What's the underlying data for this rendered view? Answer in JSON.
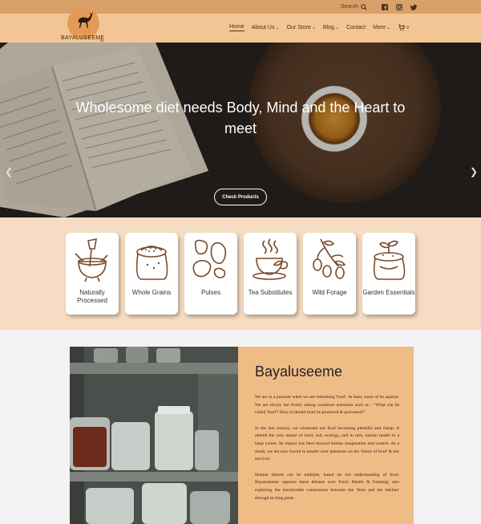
{
  "topbar": {
    "search_label": "Search",
    "icons": [
      "search-icon",
      "facebook-icon",
      "instagram-icon",
      "twitter-icon"
    ]
  },
  "brand": {
    "name": "BAYALUSEEME",
    "tm": "TM"
  },
  "nav": {
    "items": [
      {
        "label": "Home",
        "active": true,
        "dropdown": false
      },
      {
        "label": "About Us",
        "dropdown": true
      },
      {
        "label": "Our Store",
        "dropdown": true
      },
      {
        "label": "Blog",
        "dropdown": true
      },
      {
        "label": "Contact",
        "dropdown": false
      },
      {
        "label": "More",
        "dropdown": true
      }
    ],
    "cart_count": "0"
  },
  "hero": {
    "title": "Wholesome diet needs Body, Mind and the Heart to meet",
    "button": "Check Products",
    "prev_icon": "chevron-left-icon",
    "next_icon": "chevron-right-icon"
  },
  "categories": [
    {
      "label": "Naturally Processed",
      "icon": "mortar-pestle-icon"
    },
    {
      "label": "Whole Grains",
      "icon": "grain-sack-icon"
    },
    {
      "label": "Pulses",
      "icon": "beans-icon"
    },
    {
      "label": "Tea Substitutes",
      "icon": "tea-cup-icon"
    },
    {
      "label": "Wild Forage",
      "icon": "berries-branch-icon"
    },
    {
      "label": "Garden Essentials",
      "icon": "seedling-sack-icon"
    }
  ],
  "about": {
    "title": "Bayaluseeme",
    "paragraphs": [
      "We are at a juncture when we are rethinking 'food'. At least, some of its aspects. We are slowly but firmly asking ourselves questions such as - \"What can be called 'food'? How is should (not) be produced & processed?\"",
      "In the last century, we witnessed our food becoming plentiful and cheap. It altered the very nature of food, soil, ecology, and in turn, human health to a large extent. Its impact has been beyond human imagination and control. As a result, we are now forced to ponder over questions on the 'future of food' & our survival.",
      "Human futures can be multiple, based on our understanding of food. Bayaluseeme captures these debates over Food, Health & Farming; also exploring the inextricable connections between the 'farm and the kitchen' through its blog posts."
    ]
  },
  "colors": {
    "topbar": "#d9a06a",
    "nav": "#f4c594",
    "cats_bg": "#f6dcc2",
    "panel": "#f0bc86",
    "icon_brown": "#7a4a2a"
  }
}
